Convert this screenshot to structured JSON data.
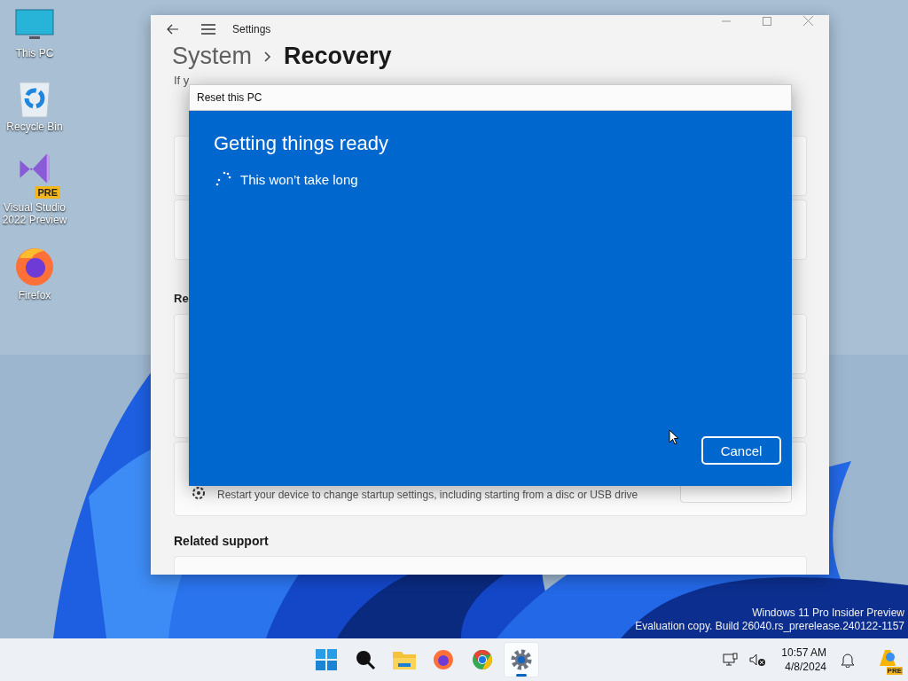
{
  "desktop_icons": [
    {
      "label": "This PC",
      "kind": "monitor"
    },
    {
      "label": "Recycle Bin",
      "kind": "recycle"
    },
    {
      "label": "Visual Studio 2022 Preview",
      "kind": "vs",
      "badge": "PRE"
    },
    {
      "label": "Firefox",
      "kind": "firefox"
    }
  ],
  "settings": {
    "title": "Settings",
    "breadcrumb_parent": "System",
    "breadcrumb_current": "Recovery",
    "intro_partial": "If y",
    "section_partial": "Re",
    "startup_description": "Restart your device to change startup settings, including starting from a disc or USB drive",
    "related_heading": "Related support"
  },
  "dialog": {
    "title": "Reset this PC",
    "heading": "Getting things ready",
    "status": "This won’t take long",
    "button": "Cancel"
  },
  "watermark": [
    "Windows 11 Pro Insider Preview",
    "Evaluation copy. Build 26040.rs_prerelease.240122-1157"
  ],
  "taskbar": {
    "apps": [
      {
        "kind": "start",
        "selected": false
      },
      {
        "kind": "search",
        "selected": false
      },
      {
        "kind": "folder",
        "selected": false
      },
      {
        "kind": "firefox",
        "selected": false
      },
      {
        "kind": "chrome",
        "selected": false
      },
      {
        "kind": "settings",
        "selected": true
      }
    ],
    "time": "10:57 AM",
    "date": "4/8/2024",
    "copilot_badge": "PRE"
  }
}
